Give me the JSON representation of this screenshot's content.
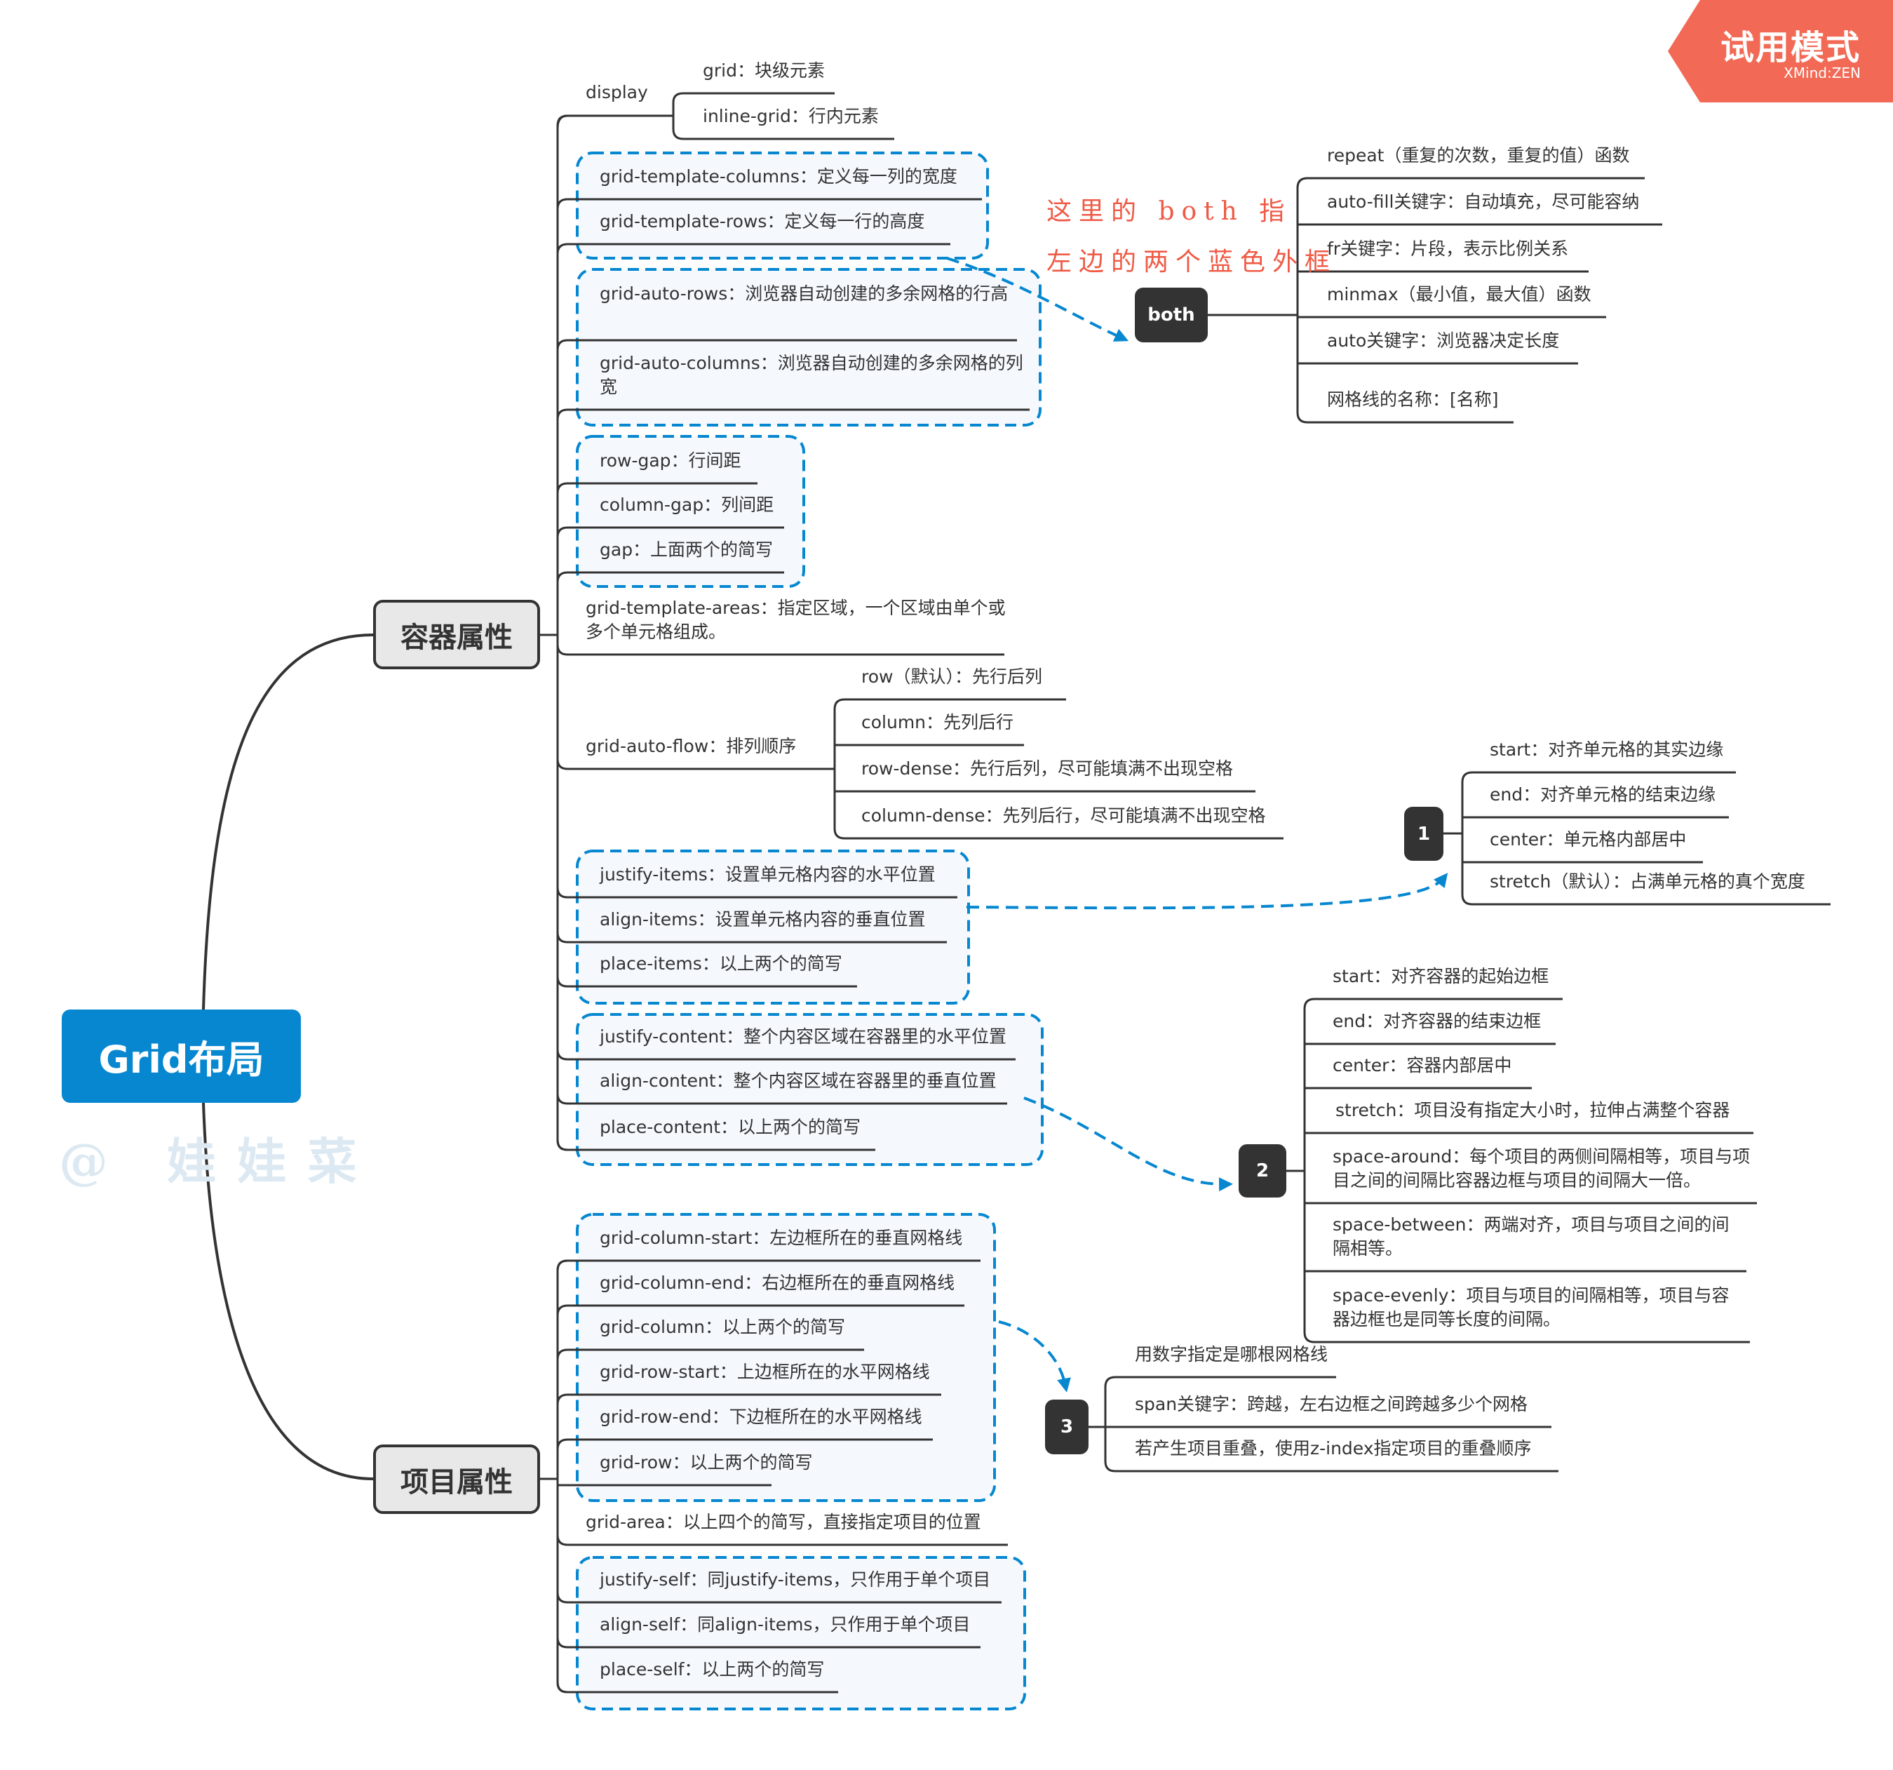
{
  "app": {
    "badge_title": "试用模式",
    "badge_subtitle": "XMind:ZEN",
    "watermark": "@ 娃娃菜"
  },
  "colors": {
    "root": "#0687d0",
    "dashed_frame": "#0687d0",
    "note": "#ef5a45",
    "dark_node": "#333333",
    "badge": "#f26a55"
  },
  "root": {
    "label": "Grid布局"
  },
  "container": {
    "label": "容器属性",
    "display": {
      "label": "display",
      "children": [
        "grid：块级元素",
        "inline-grid：行内元素"
      ]
    },
    "template": [
      "grid-template-columns：定义每一列的宽度",
      "grid-template-rows：定义每一行的高度"
    ],
    "auto": [
      "grid-auto-rows：浏览器自动创建的多余网格的行高",
      "grid-auto-columns：浏览器自动创建的多余网格的列宽"
    ],
    "gap": [
      "row-gap：行间距",
      "column-gap：列间距",
      "gap：上面两个的简写"
    ],
    "template_areas": "grid-template-areas：指定区域，一个区域由单个或多个单元格组成。",
    "auto_flow": {
      "label": "grid-auto-flow：排列顺序",
      "children": [
        "row（默认）：先行后列",
        "column：先列后行",
        "row-dense：先行后列，尽可能填满不出现空格",
        "column-dense：先列后行，尽可能填满不出现空格"
      ]
    },
    "items": [
      "justify-items：设置单元格内容的水平位置",
      "align-items：设置单元格内容的垂直位置",
      "place-items：以上两个的简写"
    ],
    "content": [
      "justify-content：整个内容区域在容器里的水平位置",
      "align-content：整个内容区域在容器里的垂直位置",
      "place-content：以上两个的简写"
    ]
  },
  "item": {
    "label": "项目属性",
    "lines": [
      "grid-column-start：左边框所在的垂直网格线",
      "grid-column-end：右边框所在的垂直网格线",
      "grid-column：以上两个的简写",
      "grid-row-start：上边框所在的水平网格线",
      "grid-row-end：下边框所在的水平网格线",
      "grid-row：以上两个的简写"
    ],
    "grid_area": "grid-area：以上四个的简写，直接指定项目的位置",
    "self": [
      "justify-self：同justify-items，只作用于单个项目",
      "align-self：同align-items，只作用于单个项目",
      "place-self：以上两个的简写"
    ]
  },
  "both": {
    "label": "both",
    "note_line1": "这里的 both 指",
    "note_line2": "左边的两个蓝色外框",
    "children": [
      "repeat（重复的次数，重复的值）函数",
      "auto-fill关键字：自动填充，尽可能容纳",
      "fr关键字：片段，表示比例关系",
      "minmax（最小值，最大值）函数",
      "auto关键字：浏览器决定长度",
      "网格线的名称：[名称]"
    ]
  },
  "node1": {
    "label": "1",
    "children": [
      "start：对齐单元格的其实边缘",
      "end：对齐单元格的结束边缘",
      "center：单元格内部居中",
      "stretch（默认）：占满单元格的真个宽度"
    ]
  },
  "node2": {
    "label": "2",
    "children": [
      "start：对齐容器的起始边框",
      "end：对齐容器的结束边框",
      "center：容器内部居中",
      "stretch：项目没有指定大小时，拉伸占满整个容器",
      "space-around：每个项目的两侧间隔相等，项目与项目之间的间隔比容器边框与项目的间隔大一倍。",
      "space-between：两端对齐，项目与项目之间的间隔相等。",
      "space-evenly：项目与项目的间隔相等，项目与容器边框也是同等长度的间隔。"
    ]
  },
  "node3": {
    "label": "3",
    "children": [
      "用数字指定是哪根网格线",
      "span关键字：跨越，左右边框之间跨越多少个网格",
      "若产生项目重叠，使用z-index指定项目的重叠顺序"
    ]
  }
}
